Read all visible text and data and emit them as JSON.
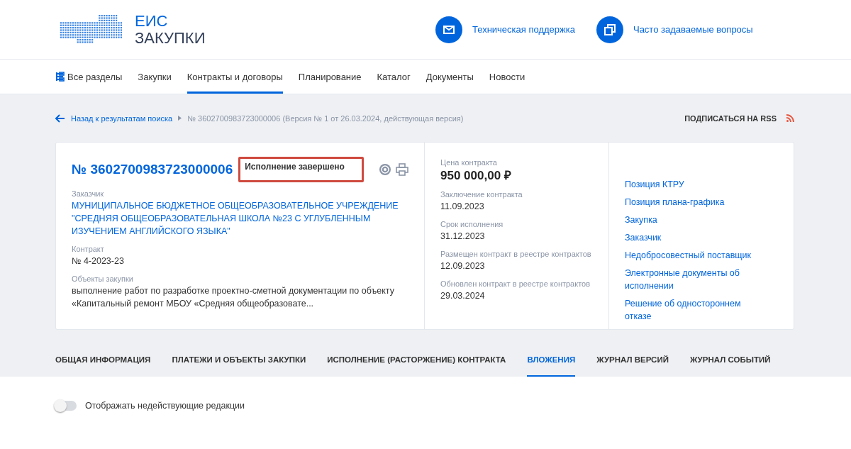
{
  "header": {
    "logo_line1": "ЕИС",
    "logo_line2": "ЗАКУПКИ",
    "links": [
      {
        "kind": "mail",
        "label": "Техническая поддержка"
      },
      {
        "kind": "faq",
        "label": "Часто задаваемые вопросы"
      }
    ]
  },
  "nav": [
    {
      "label": "Все разделы",
      "kind": "sections",
      "selected": false
    },
    {
      "label": "Закупки",
      "kind": "plain",
      "selected": false
    },
    {
      "label": "Контракты и договоры",
      "kind": "plain",
      "selected": true
    },
    {
      "label": "Планирование",
      "kind": "plain",
      "selected": false
    },
    {
      "label": "Каталог",
      "kind": "plain",
      "selected": false
    },
    {
      "label": "Документы",
      "kind": "plain",
      "selected": false
    },
    {
      "label": "Новости",
      "kind": "plain",
      "selected": false
    }
  ],
  "breadcrumb": {
    "back": "Назад к результатам поиска",
    "current": "№ 3602700983723000006 (Версия № 1 от 26.03.2024, действующая версия)"
  },
  "rss": "ПОДПИСАТЬСЯ НА RSS",
  "card": {
    "number": "№ 3602700983723000006",
    "status": {
      "text": "Исполнение завершено",
      "highlighted": true
    },
    "fields": [
      {
        "label": "Заказчик",
        "value": "МУНИЦИПАЛЬНОЕ БЮДЖЕТНОЕ ОБЩЕОБРАЗОВАТЕЛЬНОЕ УЧРЕЖДЕНИЕ \"СРЕДНЯЯ ОБЩЕОБРАЗОВАТЕЛЬНАЯ ШКОЛА №23 С УГЛУБЛЕННЫМ ИЗУЧЕНИЕМ АНГЛИЙСКОГО ЯЗЫКА\"",
        "kind": "link"
      },
      {
        "label": "Контракт",
        "value": "№ 4-2023-23",
        "kind": "text"
      },
      {
        "label": "Объекты закупки",
        "value": "выполнение работ по разработке проектно-сметной документации по объекту «Капитальный ремонт МБОУ «Средняя общеобразовате...",
        "kind": "text"
      }
    ],
    "price_label": "Цена контракта",
    "price": "950 000,00 ₽",
    "dates": [
      {
        "label": "Заключение контракта",
        "value": "11.09.2023"
      },
      {
        "label": "Срок исполнения",
        "value": "31.12.2023"
      },
      {
        "label": "Размещен контракт в реестре контрактов",
        "value": "12.09.2023"
      },
      {
        "label": "Обновлен контракт в реестре контрактов",
        "value": "29.03.2024"
      }
    ],
    "links": [
      "Позиция КТРУ",
      "Позиция плана-графика",
      "Закупка",
      "Заказчик",
      "Недобросовестный поставщик",
      "Электронные документы об исполнении",
      "Решение об одностороннем отказе"
    ]
  },
  "tabs": [
    {
      "label": "ОБЩАЯ ИНФОРМАЦИЯ",
      "selected": false
    },
    {
      "label": "ПЛАТЕЖИ И ОБЪЕКТЫ ЗАКУПКИ",
      "selected": false
    },
    {
      "label": "ИСПОЛНЕНИЕ (РАСТОРЖЕНИЕ) КОНТРАКТА",
      "selected": false
    },
    {
      "label": "ВЛОЖЕНИЯ",
      "selected": true
    },
    {
      "label": "ЖУРНАЛ ВЕРСИЙ",
      "selected": false
    },
    {
      "label": "ЖУРНАЛ СОБЫТИЙ",
      "selected": false
    }
  ],
  "toggle": {
    "label": "Отображать недействующие редакции",
    "on": false
  }
}
